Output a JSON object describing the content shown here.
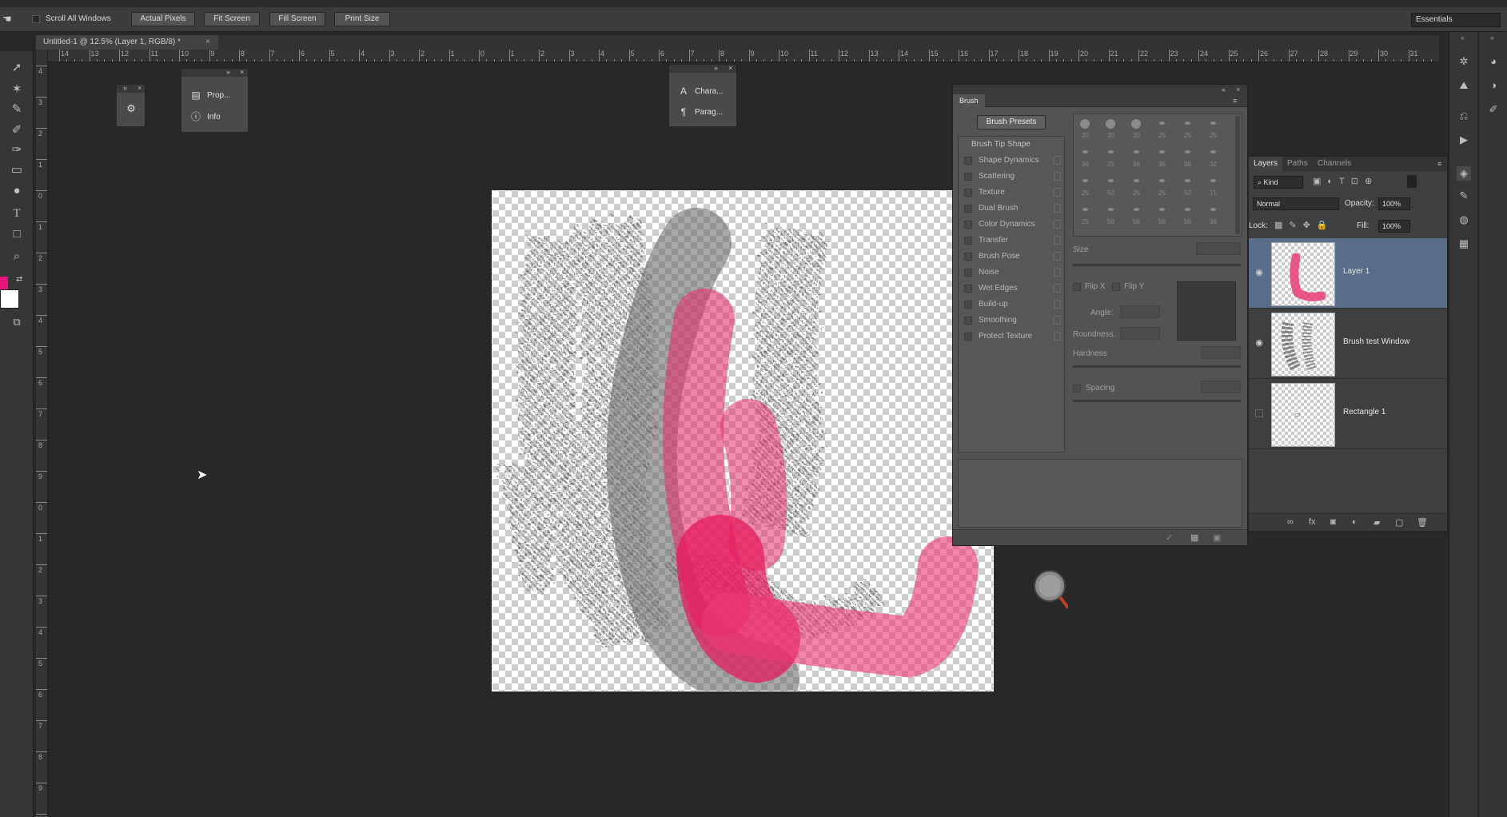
{
  "options_bar": {
    "scroll_all_label": "Scroll All Windows",
    "actual_pixels": "Actual Pixels",
    "fit_screen": "Fit Screen",
    "fill_screen": "Fill Screen",
    "print_size": "Print Size",
    "workspace": "Essentials"
  },
  "document": {
    "tab_title": "Untitled-1 @ 12.5% (Layer 1, RGB/8) *",
    "ruler_h": [
      "14",
      "13",
      "12",
      "11",
      "10",
      "9",
      "8",
      "7",
      "6",
      "5",
      "4",
      "3",
      "2",
      "1",
      "0",
      "1",
      "2",
      "3",
      "4",
      "5",
      "6",
      "7",
      "8",
      "9",
      "10",
      "11",
      "12",
      "13",
      "14",
      "15",
      "16",
      "17",
      "18",
      "19",
      "20",
      "21",
      "22",
      "23",
      "24",
      "25",
      "26",
      "27",
      "28",
      "29",
      "30",
      "31"
    ],
    "ruler_v": [
      "4",
      "3",
      "2",
      "1",
      "0",
      "1",
      "2",
      "3",
      "4",
      "5",
      "6",
      "7",
      "8",
      "9",
      "0",
      "1",
      "2",
      "3",
      "4",
      "5",
      "6",
      "7",
      "8",
      "9",
      "0"
    ]
  },
  "colors": {
    "foreground": "#e8147a",
    "background": "#ffffff",
    "layer_selected": "#596d88",
    "pink_stroke": "#e8306f"
  },
  "panels": {
    "properties": {
      "label": "Prop..."
    },
    "info": {
      "label": "Info"
    },
    "character": {
      "label": "Chara..."
    },
    "paragraph": {
      "label": "Parag..."
    }
  },
  "brush_panel": {
    "tab": "Brush",
    "presets_button": "Brush Presets",
    "tip_shape": "Brush Tip Shape",
    "options": [
      "Shape Dynamics",
      "Scattering",
      "Texture",
      "Dual Brush",
      "Color Dynamics",
      "Transfer",
      "Brush Pose",
      "Noise",
      "Wet Edges",
      "Build-up",
      "Smoothing",
      "Protect Texture"
    ],
    "tip_sizes": [
      [
        "30",
        "30",
        "30",
        "25",
        "25",
        "25"
      ],
      [
        "36",
        "25",
        "36",
        "36",
        "36",
        "32"
      ],
      [
        "25",
        "50",
        "25",
        "25",
        "50",
        "71"
      ],
      [
        "25",
        "50",
        "50",
        "50",
        "50",
        "36"
      ]
    ],
    "size_label": "Size",
    "flip_x": "Flip X",
    "flip_y": "Flip Y",
    "angle": "Angle:",
    "roundness": "Roundness:",
    "hardness": "Hardness",
    "spacing": "Spacing"
  },
  "layers_panel": {
    "tabs": [
      "Layers",
      "Paths",
      "Channels"
    ],
    "filter_kind": "Kind",
    "blend_mode": "Normal",
    "opacity_label": "Opacity:",
    "opacity_value": "100%",
    "lock_label": "Lock:",
    "fill_label": "Fill:",
    "fill_value": "100%",
    "layers": [
      {
        "name": "Layer 1",
        "visible": true,
        "selected": true
      },
      {
        "name": "Brush test Window",
        "visible": true,
        "selected": false
      },
      {
        "name": "Rectangle 1",
        "visible": false,
        "selected": false
      }
    ],
    "footer_icons": [
      "link-icon",
      "fx-icon",
      "mask-icon",
      "adjustment-icon",
      "group-icon",
      "new-layer-icon",
      "trash-icon"
    ]
  },
  "dock_icons": [
    "navigator-icon",
    "histogram-icon",
    "history-icon",
    "actions-icon",
    "layers-icon",
    "paths-icon",
    "channels-icon",
    "swatches-icon"
  ],
  "dock2_icons": [
    "color-icon",
    "adjustments-icon",
    "styles-icon"
  ]
}
